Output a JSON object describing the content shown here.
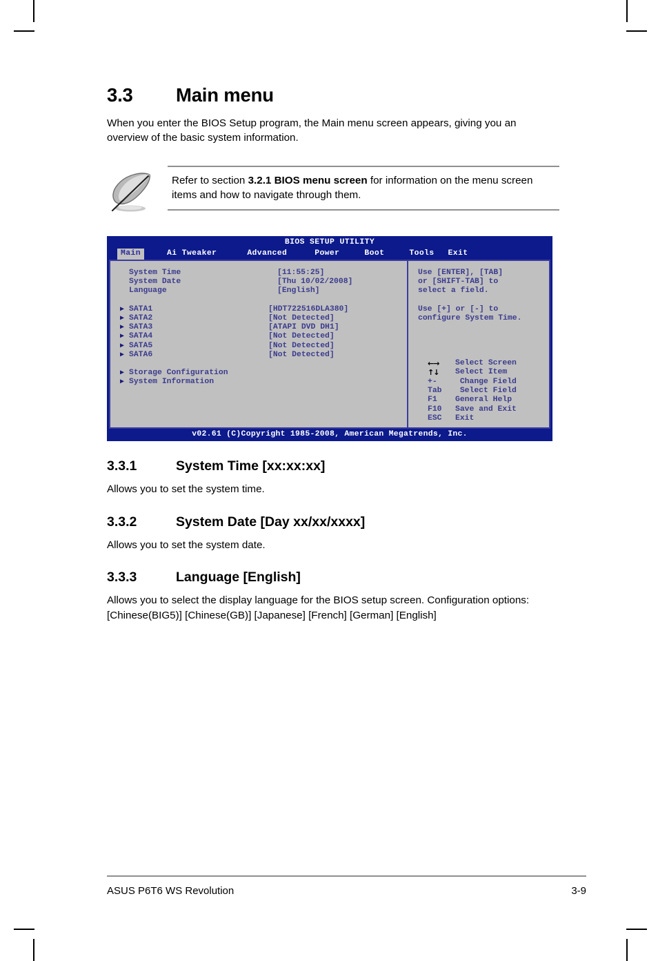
{
  "section": {
    "number": "3.3",
    "title": "Main menu",
    "intro": "When you enter the BIOS Setup program, the Main menu screen appears, giving you an overview of the basic system information."
  },
  "note": {
    "icon": "quill-pen-icon",
    "text_before": "Refer to section ",
    "text_bold": "3.2.1 BIOS menu screen",
    "text_after": " for information on the menu screen items and how to navigate through them."
  },
  "bios": {
    "title": "BIOS SETUP UTILITY",
    "footer": "v02.61 (C)Copyright 1985-2008, American Megatrends, Inc.",
    "colors": {
      "background": "#0c1a8c",
      "panel": "#c0c0c0",
      "text": "#3b3b8f",
      "border": "#3b3b9e",
      "active_tab_text": "#2a2a9c"
    },
    "tabs": [
      {
        "label": "Main",
        "active": true
      },
      {
        "label": "Ai Tweaker",
        "active": false
      },
      {
        "label": "Advanced",
        "active": false
      },
      {
        "label": "Power",
        "active": false
      },
      {
        "label": "Boot",
        "active": false
      },
      {
        "label": "Tools",
        "active": false
      },
      {
        "label": "Exit",
        "active": false
      }
    ],
    "fields": [
      {
        "label": "System Time",
        "value": "[11:55:25]",
        "submenu": false
      },
      {
        "label": "System Date",
        "value": "[Thu 10/02/2008]",
        "submenu": false
      },
      {
        "label": "Language",
        "value": "[English]",
        "submenu": false
      }
    ],
    "drives": [
      {
        "label": "SATA1",
        "value": "[HDT722516DLA380]",
        "submenu": true
      },
      {
        "label": "SATA2",
        "value": "[Not Detected]",
        "submenu": true
      },
      {
        "label": "SATA3",
        "value": "[ATAPI DVD DH1]",
        "submenu": true
      },
      {
        "label": "SATA4",
        "value": "[Not Detected]",
        "submenu": true
      },
      {
        "label": "SATA5",
        "value": "[Not Detected]",
        "submenu": true
      },
      {
        "label": "SATA6",
        "value": "[Not Detected]",
        "submenu": true
      }
    ],
    "submenus": [
      {
        "label": "Storage Configuration",
        "value": "",
        "submenu": true
      },
      {
        "label": "System Information",
        "value": "",
        "submenu": true
      }
    ],
    "help": {
      "lines": [
        "Use [ENTER], [TAB]",
        "or [SHIFT-TAB] to",
        "select a field.",
        "",
        "Use [+] or [-] to",
        "configure System Time."
      ]
    },
    "legend": [
      {
        "key": "←→",
        "glyph": true,
        "action": "Select Screen"
      },
      {
        "key": "↑↓",
        "glyph": true,
        "action": "Select Item"
      },
      {
        "key": "+-",
        "glyph": false,
        "action": " Change Field"
      },
      {
        "key": "Tab",
        "glyph": false,
        "action": " Select Field"
      },
      {
        "key": "F1",
        "glyph": false,
        "action": "General Help"
      },
      {
        "key": "F10",
        "glyph": false,
        "action": "Save and Exit"
      },
      {
        "key": "ESC",
        "glyph": false,
        "action": "Exit"
      }
    ]
  },
  "subsections": [
    {
      "number": "3.3.1",
      "title": "System Time [xx:xx:xx]",
      "body": "Allows you to set the system time."
    },
    {
      "number": "3.3.2",
      "title": "System Date [Day xx/xx/xxxx]",
      "body": "Allows you to set the system date."
    },
    {
      "number": "3.3.3",
      "title": "Language [English]",
      "body": "Allows you to select the display language for the BIOS setup screen. Configuration options: [Chinese(BIG5)] [Chinese(GB)] [Japanese] [French] [German] [English]"
    }
  ],
  "footer": {
    "product": "ASUS P6T6 WS Revolution",
    "page": "3-9"
  }
}
